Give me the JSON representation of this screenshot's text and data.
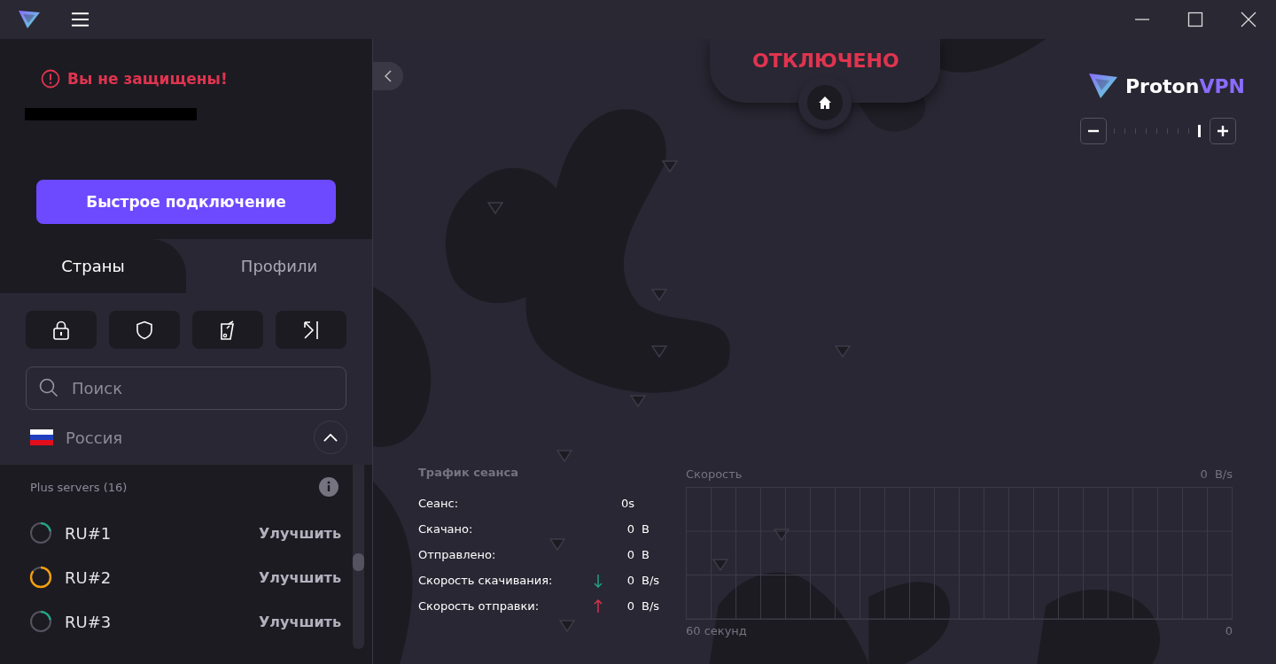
{
  "status": {
    "warning": "Вы не защищены!",
    "redacted": true,
    "state": "ОТКЛЮЧЕНО"
  },
  "quick_connect": "Быстрое подключение",
  "tabs": [
    {
      "label": "Страны",
      "selected": true
    },
    {
      "label": "Профили",
      "selected": false
    }
  ],
  "search": {
    "placeholder": "Поиск"
  },
  "country": {
    "name": "Россия",
    "expanded": true
  },
  "server_group": "Plus servers (16)",
  "servers": [
    {
      "name": "RU#1",
      "kind": "low",
      "action": "Улучшить"
    },
    {
      "name": "RU#2",
      "kind": "high",
      "action": "Улучшить"
    },
    {
      "name": "RU#3",
      "kind": "low",
      "action": "Улучшить"
    }
  ],
  "brand": {
    "name": "Proton",
    "accent": "VPN"
  },
  "zoom": {
    "level": 1
  },
  "traffic": {
    "title": "Трафик сеанса",
    "rows": [
      {
        "kind": "plain",
        "label": "Сеанс:",
        "value": "0s"
      },
      {
        "kind": "plain",
        "label": "Скачано:",
        "value": "0",
        "unit": "B"
      },
      {
        "kind": "plain",
        "label": "Отправлено:",
        "value": "0",
        "unit": "B"
      },
      {
        "kind": "down",
        "label": "Скорость скачивания:",
        "value": "0",
        "unit": "B/s"
      },
      {
        "kind": "up",
        "label": "Скорость отправки:",
        "value": "0",
        "unit": "B/s"
      }
    ]
  },
  "speed": {
    "title": "Скорость",
    "value": "0  B/s",
    "x_start": "60 секунд",
    "x_end": "0"
  }
}
